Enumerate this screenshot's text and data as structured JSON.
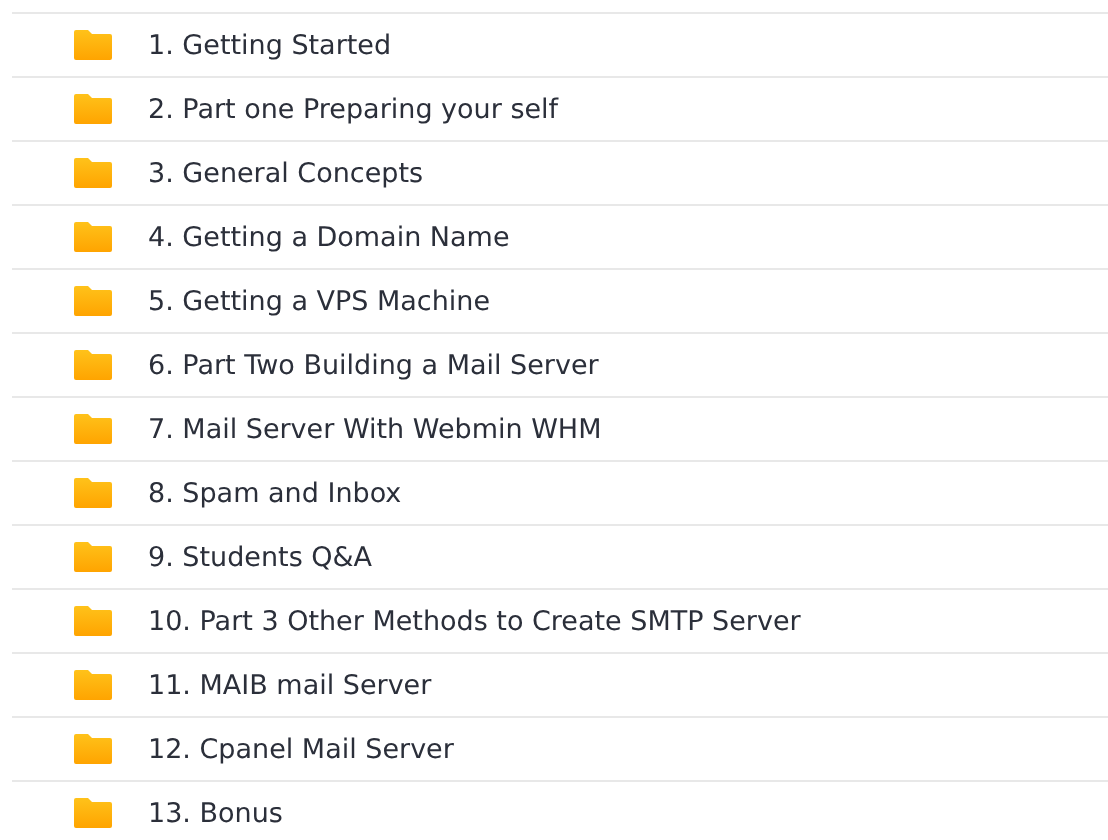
{
  "folders": [
    {
      "name": "1. Getting Started"
    },
    {
      "name": "2. Part one Preparing your self"
    },
    {
      "name": "3. General Concepts"
    },
    {
      "name": "4. Getting a Domain Name"
    },
    {
      "name": "5. Getting a VPS Machine"
    },
    {
      "name": "6. Part Two Building a Mail Server"
    },
    {
      "name": "7. Mail Server With Webmin WHM"
    },
    {
      "name": "8. Spam and Inbox"
    },
    {
      "name": "9. Students Q&A"
    },
    {
      "name": "10. Part 3 Other Methods to Create SMTP Server"
    },
    {
      "name": "11. MAIB mail Server"
    },
    {
      "name": "12. Cpanel Mail Server"
    },
    {
      "name": "13. Bonus"
    }
  ]
}
